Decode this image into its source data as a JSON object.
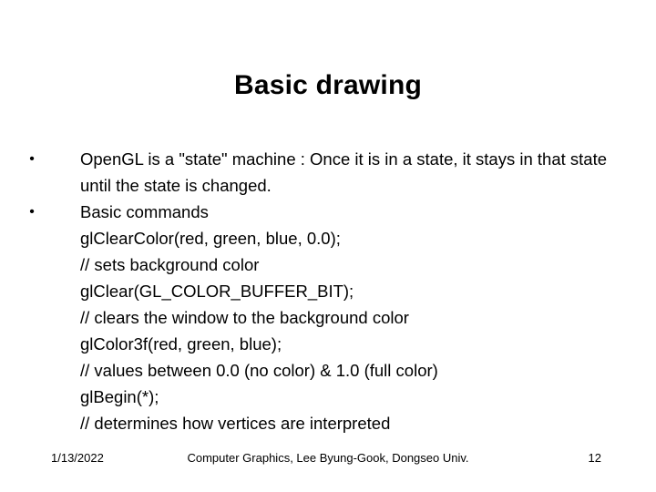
{
  "slide": {
    "title": "Basic drawing",
    "bullets": [
      {
        "marker": "•",
        "text": "OpenGL is a \"state\" machine : Once it is in a state, it stays in that state until the state is changed."
      },
      {
        "marker": "•",
        "text": "Basic commands"
      }
    ],
    "commands": [
      "glClearColor(red, green, blue, 0.0);",
      "// sets background color",
      "glClear(GL_COLOR_BUFFER_BIT);",
      "// clears the window to the background color",
      "glColor3f(red, green, blue);",
      "// values between 0.0 (no color) & 1.0 (full color)",
      "glBegin(*);",
      "// determines how vertices are interpreted"
    ],
    "footer": {
      "date": "1/13/2022",
      "center": "Computer Graphics, Lee Byung-Gook, Dongseo Univ.",
      "page_number": "12"
    }
  }
}
